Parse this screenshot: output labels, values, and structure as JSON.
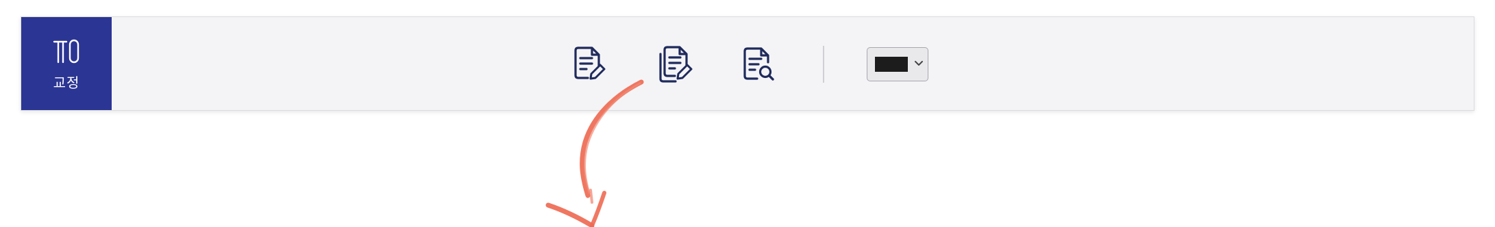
{
  "mode_tab": {
    "label": "교정",
    "icon": "proofread-icon"
  },
  "toolbar": {
    "tools": [
      {
        "name": "edit-document-icon"
      },
      {
        "name": "edit-copy-documents-icon"
      },
      {
        "name": "document-search-icon"
      }
    ],
    "color_select": {
      "value": "#1c1c1c"
    }
  },
  "colors": {
    "brand": "#2b3593",
    "toolbar_bg": "#f4f4f6",
    "icon": "#1f2a5c",
    "annotation": "#ee6a52"
  },
  "annotation": {
    "icon": "curved-arrow-icon"
  }
}
